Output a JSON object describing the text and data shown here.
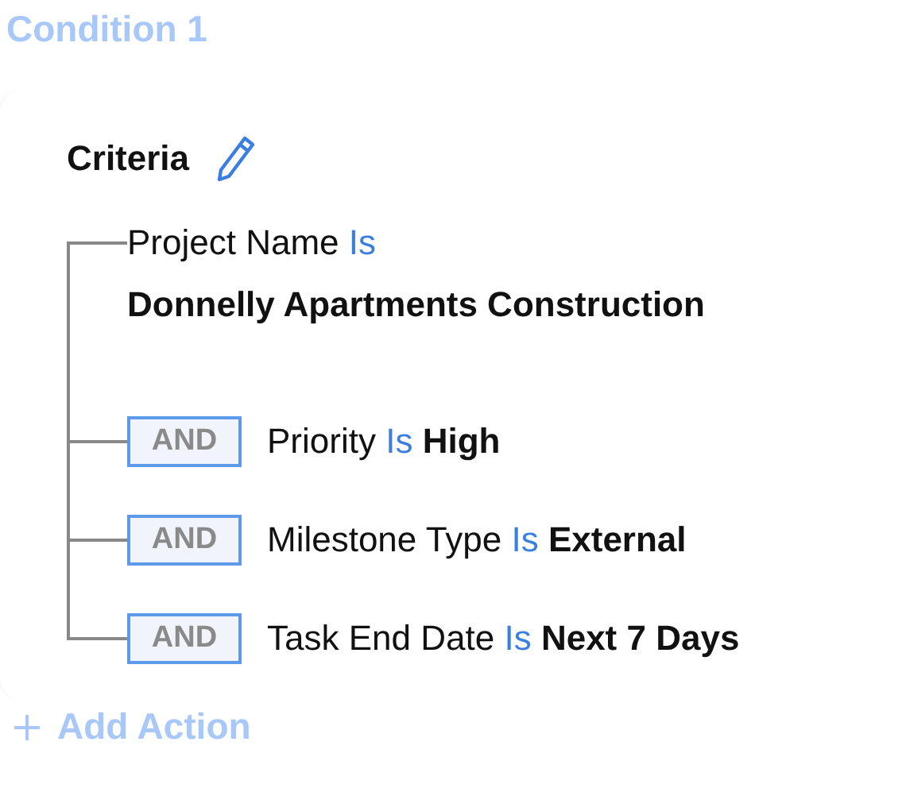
{
  "condition_title": "Condition 1",
  "criteria": {
    "heading": "Criteria",
    "items": [
      {
        "kind": "first",
        "field": "Project Name",
        "operator": "Is",
        "value": "Donnelly Apartments Construction"
      },
      {
        "kind": "joined",
        "conjunction": "AND",
        "field": "Priority",
        "operator": "Is",
        "value": "High"
      },
      {
        "kind": "joined",
        "conjunction": "AND",
        "field": "Milestone Type",
        "operator": "Is",
        "value": "External"
      },
      {
        "kind": "joined",
        "conjunction": "AND",
        "field": "Task End Date",
        "operator": "Is",
        "value": "Next 7 Days"
      }
    ]
  },
  "add_action": {
    "label": "Add Action"
  }
}
